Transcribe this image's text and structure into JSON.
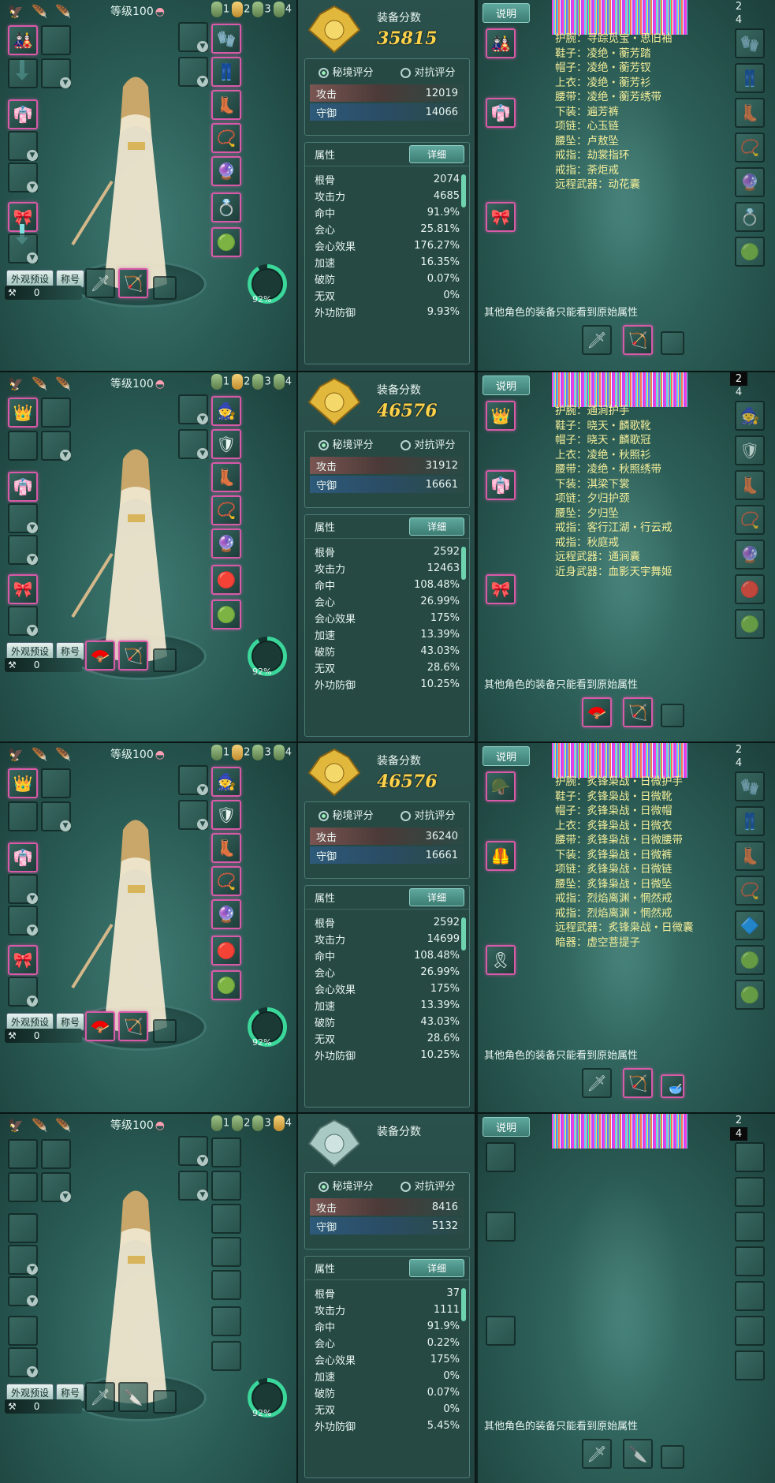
{
  "common": {
    "level_label": "等级100",
    "slot_numbers": [
      "1",
      "2",
      "3",
      "4"
    ],
    "appearance_button": "外观预设",
    "title_button": "称号",
    "coin_value": "0",
    "gauge_value": "92%",
    "score_label": "装备分数",
    "tab_secret": "秘境评分",
    "tab_pvp": "对抗评分",
    "attack_label": "攻击",
    "defense_label": "守御",
    "attr_header": "属性",
    "detail_button": "详细",
    "explain_button": "说明",
    "page_numbers": [
      "2",
      "4"
    ],
    "note_text": "其他角色的装备只能看到原始属性",
    "attr_names": [
      "根骨",
      "攻击力",
      "命中",
      "会心",
      "会心效果",
      "加速",
      "破防",
      "无双",
      "外功防御"
    ]
  },
  "panels": [
    {
      "score": "35815",
      "attack": "12019",
      "defense": "14066",
      "attr_values": [
        "2074",
        "4685",
        "91.9%",
        "25.81%",
        "176.27%",
        "16.35%",
        "0.07%",
        "0%",
        "9.93%"
      ],
      "active_page": "2",
      "equipment": [
        "护腕：寻踪觅宝・思旧袖",
        "鞋子：凌绝・蘅芳踏",
        "帽子：凌绝・蘅芳钗",
        "上衣：凌绝・蘅芳衫",
        "腰带：凌绝・蘅芳绣带",
        "下装：遍芳裤",
        "项链：心玉链",
        "腰坠：卢敖坠",
        "戒指：劫裳指环",
        "戒指：荼炬戒",
        "远程武器：动花囊"
      ]
    },
    {
      "score": "46576",
      "attack": "31912",
      "defense": "16661",
      "attr_values": [
        "2592",
        "12463",
        "108.48%",
        "26.99%",
        "175%",
        "13.39%",
        "43.03%",
        "28.6%",
        "10.25%"
      ],
      "active_page": "2",
      "equipment": [
        "护腕：通涧护手",
        "鞋子：晓天・麟歌靴",
        "帽子：晓天・麟歌冠",
        "上衣：凌绝・秋照衫",
        "腰带：凌绝・秋照绣带",
        "下装：淇梁下裳",
        "项链：夕归护颈",
        "腰坠：夕归坠",
        "戒指：客行江湖・行云戒",
        "戒指：秋庭戒",
        "远程武器：通涧囊",
        "近身武器：血影天宇舞姬"
      ]
    },
    {
      "score": "46576",
      "attack": "36240",
      "defense": "16661",
      "attr_values": [
        "2592",
        "14699",
        "108.48%",
        "26.99%",
        "175%",
        "13.39%",
        "43.03%",
        "28.6%",
        "10.25%"
      ],
      "active_page": "",
      "equipment": [
        "护腕：炙锋枭战・日微护手",
        "鞋子：炙锋枭战・日微靴",
        "帽子：炙锋枭战・日微帽",
        "上衣：炙锋枭战・日微衣",
        "腰带：炙锋枭战・日微腰带",
        "下装：炙锋枭战・日微裤",
        "项链：炙锋枭战・日微链",
        "腰坠：炙锋枭战・日微坠",
        "戒指：烈焰离渊・惘然戒",
        "戒指：烈焰离渊・惘然戒",
        "远程武器：炙锋枭战・日微囊",
        "暗器：虚空菩提子"
      ]
    },
    {
      "score": "",
      "attack": "8416",
      "defense": "5132",
      "attr_values": [
        "37",
        "1111",
        "91.9%",
        "0.22%",
        "175%",
        "0%",
        "0.07%",
        "0%",
        "5.45%"
      ],
      "active_page": "4",
      "equipment": []
    }
  ]
}
